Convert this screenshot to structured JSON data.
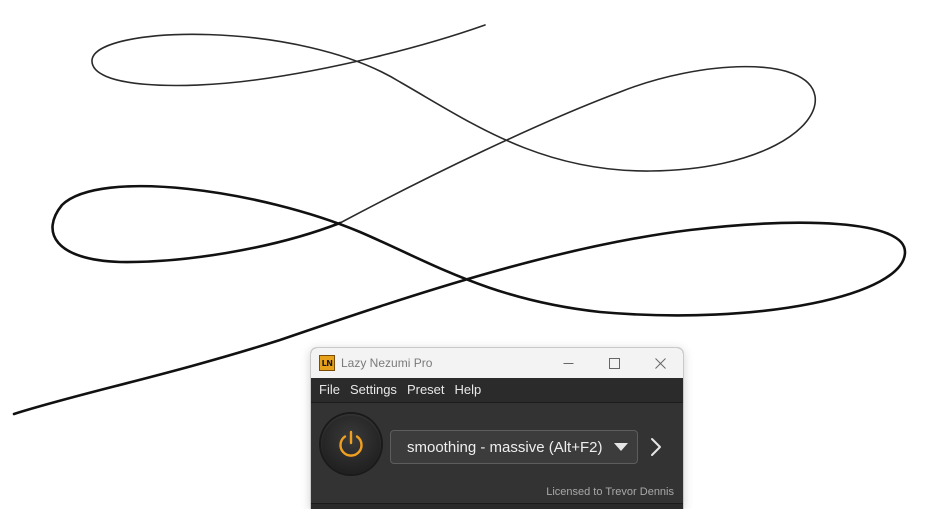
{
  "window": {
    "title": "Lazy Nezumi Pro",
    "logo_text": "LN",
    "controls": [
      "minimize",
      "maximize",
      "close"
    ]
  },
  "menu": {
    "items": [
      "File",
      "Settings",
      "Preset",
      "Help"
    ]
  },
  "main": {
    "power_state": "on",
    "preset": "smoothing - massive (Alt+F2)",
    "license": "Licensed to Trevor Dennis"
  },
  "colors": {
    "accent": "#f0a020",
    "background": "#333333"
  }
}
